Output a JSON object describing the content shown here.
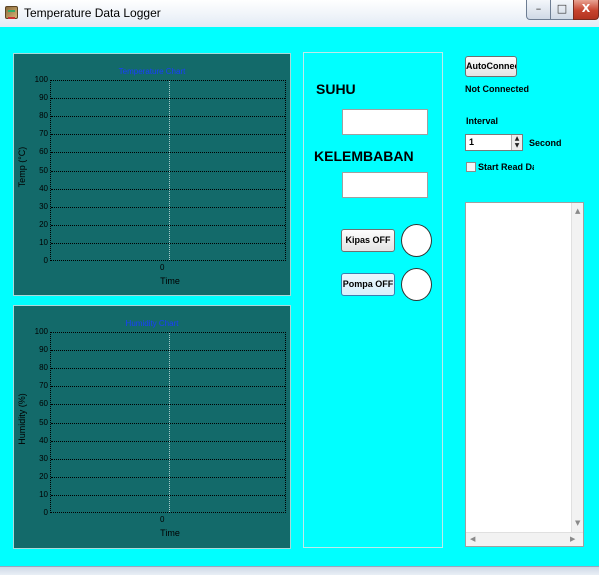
{
  "window": {
    "title": "Temperature Data Logger",
    "background": "#00ffff",
    "controls": {
      "minimize": "–",
      "maximize": "□",
      "close": "X"
    }
  },
  "temperature_chart": {
    "title": "Temperature Chart",
    "ylabel": "Temp (°C)",
    "xlabel": "Time",
    "x_tick": "0",
    "y_ticks": [
      "100",
      "90",
      "80",
      "70",
      "60",
      "50",
      "40",
      "30",
      "20",
      "10",
      "0"
    ]
  },
  "humidity_chart": {
    "title": "Humidity Chart",
    "ylabel": "Humidity (%)",
    "xlabel": "Time",
    "x_tick": "0",
    "y_ticks": [
      "100",
      "90",
      "80",
      "70",
      "60",
      "50",
      "40",
      "30",
      "20",
      "10",
      "0"
    ]
  },
  "chart_data": [
    {
      "type": "line",
      "title": "Temperature Chart",
      "xlabel": "Time",
      "ylabel": "Temp (°C)",
      "ylim": [
        0,
        100
      ],
      "x_ticks": [
        "0"
      ],
      "series": [],
      "grid": true
    },
    {
      "type": "line",
      "title": "Humidity Chart",
      "xlabel": "Time",
      "ylabel": "Humidity (%)",
      "ylim": [
        0,
        100
      ],
      "x_ticks": [
        "0"
      ],
      "series": [],
      "grid": true
    }
  ],
  "readings": {
    "suhu_label": "SUHU",
    "suhu_value": "",
    "kelembaban_label": "KELEMBABAN",
    "kelembaban_value": ""
  },
  "actuators": {
    "kipas_button": "Kipas OFF",
    "pompa_button": "Pompa OFF"
  },
  "connection": {
    "autoconnect_button": "AutoConnect",
    "status": "Not Connected"
  },
  "interval": {
    "label": "Interval",
    "value": "1",
    "unit": "Second"
  },
  "start_read": {
    "label": "Start Read Data",
    "checked": false
  },
  "log": {
    "text": ""
  }
}
